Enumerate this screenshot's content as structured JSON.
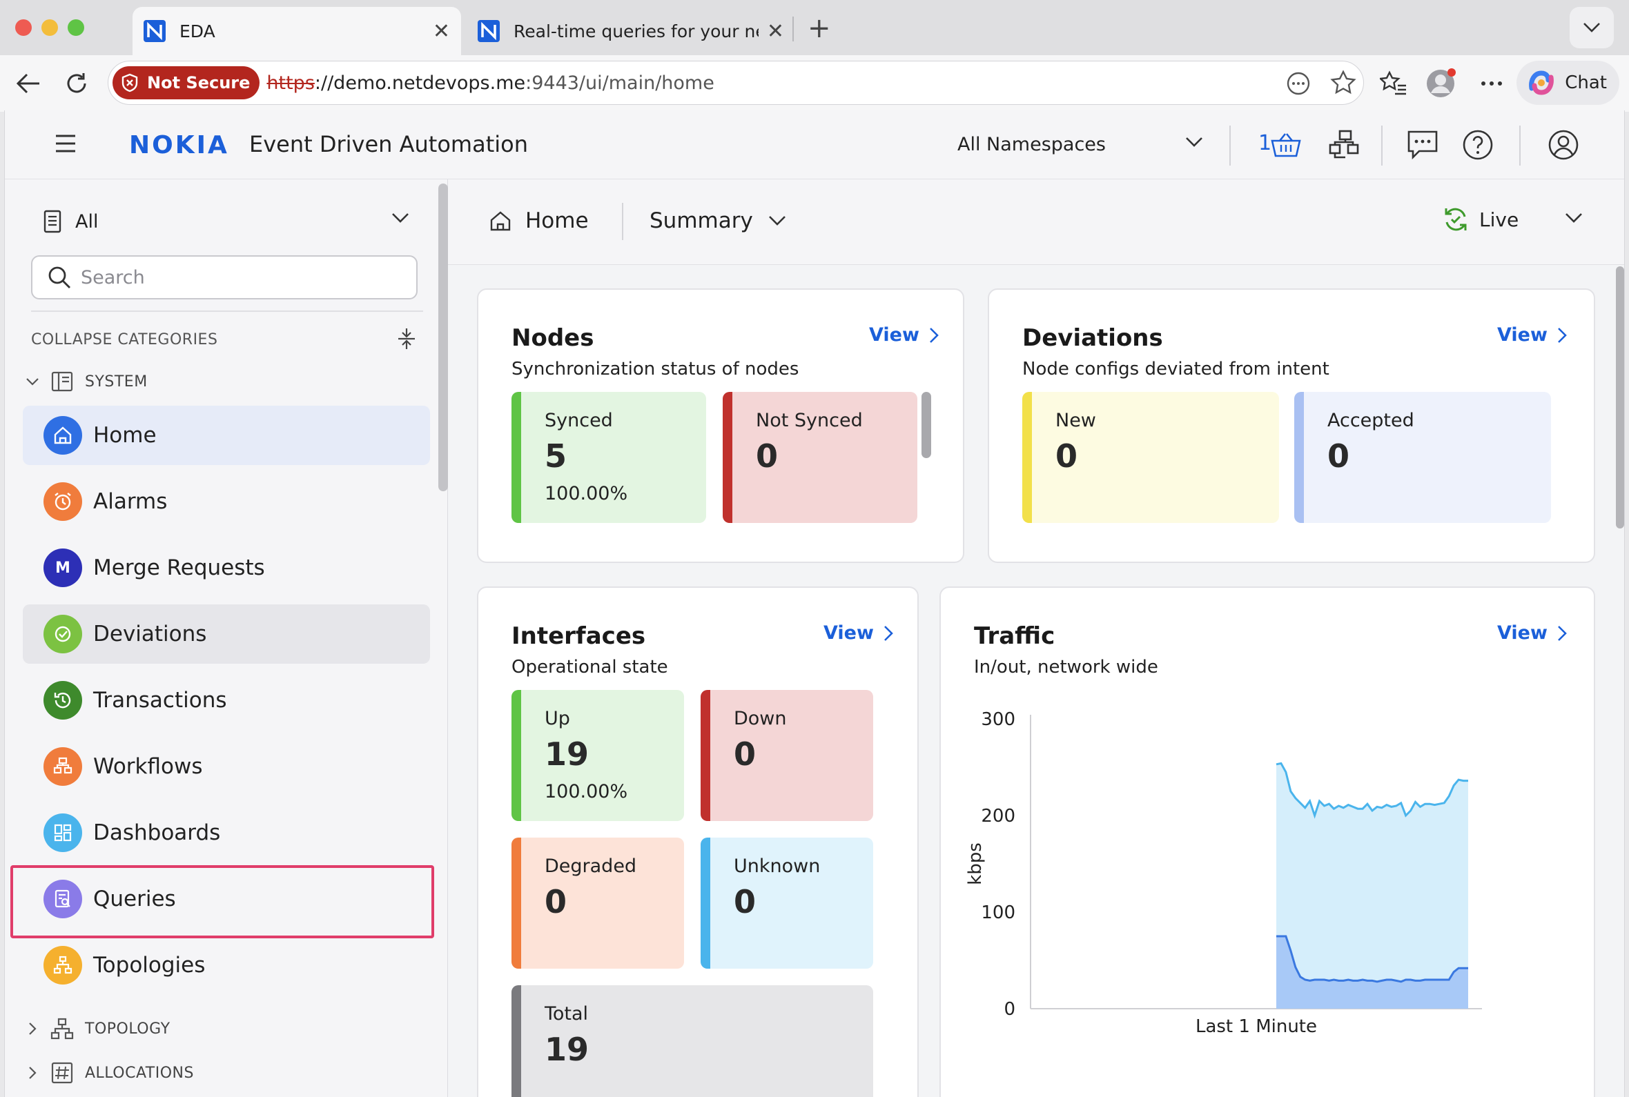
{
  "browser": {
    "tabs": [
      {
        "title": "EDA",
        "active": true
      },
      {
        "title": "Real-time queries for your netwo",
        "active": false
      }
    ],
    "security_label": "Not Secure",
    "url_scheme": "https",
    "url_host": "://demo.netdevops.me",
    "url_rest": ":9443/ui/main/home",
    "chat_label": "Chat"
  },
  "app": {
    "title": "Event Driven Automation",
    "namespace": "All Namespaces",
    "basket_count": "1"
  },
  "sidebar": {
    "filter": "All",
    "search_placeholder": "Search",
    "collapse_label": "COLLAPSE CATEGORIES",
    "system_label": "SYSTEM",
    "topology_label": "TOPOLOGY",
    "allocations_label": "ALLOCATIONS",
    "items": [
      {
        "label": "Home",
        "color": "#2f6fe3"
      },
      {
        "label": "Alarms",
        "color": "#f07c3c"
      },
      {
        "label": "Merge Requests",
        "color": "#2d2fb6",
        "letter": "M"
      },
      {
        "label": "Deviations",
        "color": "#7cc242"
      },
      {
        "label": "Transactions",
        "color": "#3e8a2c"
      },
      {
        "label": "Workflows",
        "color": "#f07c3c"
      },
      {
        "label": "Dashboards",
        "color": "#4ab4ec"
      },
      {
        "label": "Queries",
        "color": "#8a7be8"
      },
      {
        "label": "Topologies",
        "color": "#f5b02e"
      }
    ]
  },
  "main": {
    "crumb_home": "Home",
    "crumb_view": "Summary",
    "live_label": "Live",
    "view_label": "View",
    "nodes": {
      "title": "Nodes",
      "subtitle": "Synchronization status of nodes",
      "synced_label": "Synced",
      "synced_value": "5",
      "synced_pct": "100.00%",
      "not_synced_label": "Not Synced",
      "not_synced_value": "0"
    },
    "deviations": {
      "title": "Deviations",
      "subtitle": "Node configs deviated from intent",
      "new_label": "New",
      "new_value": "0",
      "accepted_label": "Accepted",
      "accepted_value": "0"
    },
    "interfaces": {
      "title": "Interfaces",
      "subtitle": "Operational state",
      "up_label": "Up",
      "up_value": "19",
      "up_pct": "100.00%",
      "down_label": "Down",
      "down_value": "0",
      "degraded_label": "Degraded",
      "degraded_value": "0",
      "unknown_label": "Unknown",
      "unknown_value": "0",
      "total_label": "Total",
      "total_value": "19"
    },
    "traffic": {
      "title": "Traffic",
      "subtitle": "In/out, network wide"
    }
  },
  "chart_data": {
    "type": "area",
    "title": "Traffic",
    "subtitle": "In/out, network wide",
    "xlabel": "Last 1 Minute",
    "ylabel": "kbps",
    "ylim": [
      0,
      300
    ],
    "yticks": [
      0,
      100,
      200,
      300
    ],
    "x": [
      0,
      1,
      2,
      3,
      4,
      5,
      6,
      7,
      8,
      9,
      10,
      11,
      12,
      13,
      14,
      15,
      16,
      17,
      18,
      19,
      20,
      21,
      22,
      23,
      24,
      25,
      26,
      27,
      28,
      29,
      30,
      31,
      32,
      33,
      34,
      35,
      36,
      37,
      38,
      39,
      40
    ],
    "series": [
      {
        "color": "#4ab4ec",
        "values": [
          253,
          254,
          245,
          225,
          218,
          213,
          208,
          215,
          200,
          215,
          210,
          212,
          207,
          210,
          208,
          211,
          209,
          207,
          207,
          212,
          205,
          209,
          208,
          211,
          209,
          210,
          213,
          200,
          205,
          214,
          209,
          212,
          212,
          211,
          212,
          213,
          220,
          231,
          237,
          236,
          236
        ]
      },
      {
        "color": "#3a78e0",
        "values": [
          75,
          75,
          75,
          60,
          43,
          33,
          30,
          29,
          30,
          30,
          30,
          29,
          30,
          29,
          29,
          30,
          29,
          29,
          30,
          29,
          29,
          28,
          29,
          30,
          30,
          29,
          28,
          30,
          30,
          29,
          29,
          30,
          30,
          30,
          30,
          30,
          30,
          38,
          42,
          42,
          42
        ]
      }
    ],
    "grid": false
  }
}
